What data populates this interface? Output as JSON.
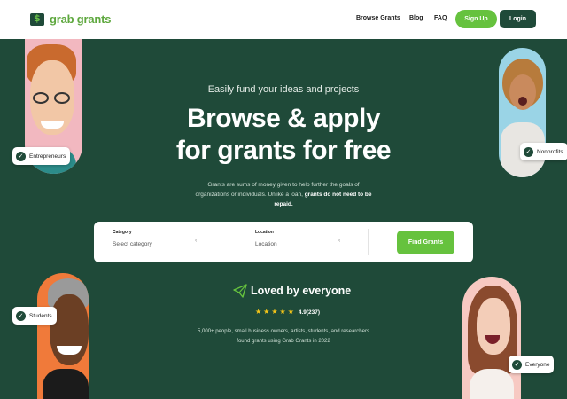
{
  "header": {
    "logo_text": "grab grants",
    "nav": [
      "Browse Grants",
      "Blog",
      "FAQ"
    ],
    "signup_label": "Sign Up",
    "login_label": "Login"
  },
  "hero": {
    "eyebrow": "Easily fund your ideas and projects",
    "headline_line1": "Browse & apply",
    "headline_line2": "for grants for free",
    "desc_plain": "Grants are sums of money given to help further the goals of organizations or individuals. Unlike a loan, ",
    "desc_bold": "grants do not need to be repaid."
  },
  "search": {
    "category_label": "Category",
    "category_placeholder": "Select category",
    "location_label": "Location",
    "location_placeholder": "Location",
    "find_label": "Find Grants"
  },
  "loved": {
    "title": "Loved by everyone",
    "stars": 5,
    "rating_text": "4.9(237)",
    "users_text": "5,000+ people, small business owners, artists, students, and researchers found grants using Grab Grants in 2022"
  },
  "tags": {
    "entrepreneurs": "Entrepreneurs",
    "nonprofits": "Nonprofits",
    "students": "Students",
    "everyone": "Everyone"
  },
  "colors": {
    "background": "#1f4a39",
    "accent": "#66c23e",
    "star": "#f5c518"
  }
}
